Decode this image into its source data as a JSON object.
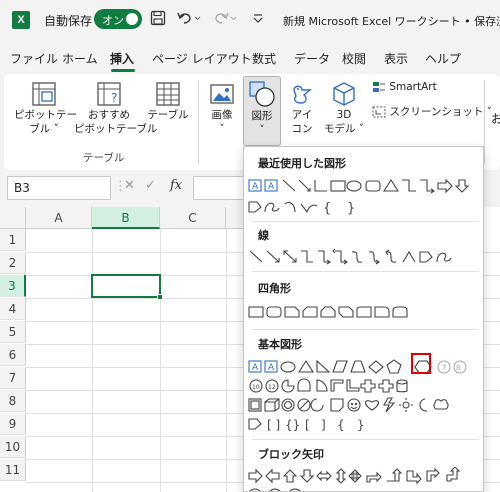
{
  "titlebar": {
    "app_icon": "excel-logo",
    "autosave_label": "自動保存",
    "autosave_state": "オン",
    "doc_title": "新規 Microsoft Excel ワークシート • 保存済み"
  },
  "tabs": [
    "ファイル",
    "ホーム",
    "挿入",
    "ページ レイアウト",
    "数式",
    "データ",
    "校閲",
    "表示",
    "ヘルプ"
  ],
  "active_tab": "挿入",
  "ribbon": {
    "pivot_table": "ピボットテー\nブル ˅",
    "recommended_pivot": "おすすめ\nピボットテーブル",
    "table": "テーブル",
    "group_label": "テーブル",
    "image": "画像\n˅",
    "shapes": "図形\n˅",
    "icons": "アイ\nコン",
    "model3d": "3D\nモデル ˅",
    "smartart": "SmartArt",
    "screenshot": "スクリーンショット ˅",
    "cut_off": "お"
  },
  "formula_bar": {
    "name_box": "B3",
    "fx": "fx"
  },
  "grid": {
    "columns": [
      "A",
      "B",
      "C"
    ],
    "rows": [
      "1",
      "2",
      "3",
      "4",
      "5",
      "6",
      "7",
      "8",
      "9",
      "10",
      "11"
    ],
    "active_cell": "B3"
  },
  "shapes_menu": {
    "recent": "最近使用した図形",
    "lines": "線",
    "rectangles": "四角形",
    "basic": "基本図形",
    "block_arrows": "ブロック矢印"
  },
  "colors": {
    "accent": "#107c41",
    "highlight": "#e00000",
    "shape_blue": "#2f6fc5"
  }
}
